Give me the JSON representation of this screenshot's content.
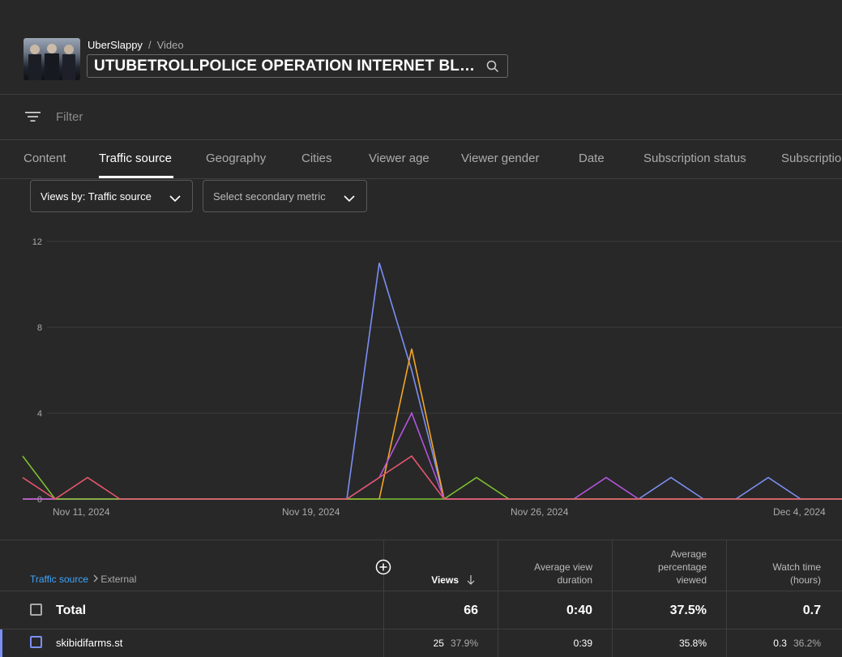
{
  "header": {
    "channel": "UberSlappy",
    "separator": "/",
    "section": "Video",
    "video_title": "UTUBETROLLPOLICE OPERATION INTERNET BLACKOUT"
  },
  "filter": {
    "placeholder": "Filter"
  },
  "tabs": [
    {
      "label": "Content"
    },
    {
      "label": "Traffic source",
      "active": true
    },
    {
      "label": "Geography"
    },
    {
      "label": "Cities"
    },
    {
      "label": "Viewer age"
    },
    {
      "label": "Viewer gender"
    },
    {
      "label": "Date"
    },
    {
      "label": "Subscription status"
    },
    {
      "label": "Subscription source"
    }
  ],
  "dropdowns": {
    "primary": "Views by: Traffic source",
    "secondary": "Select secondary metric"
  },
  "chart_data": {
    "type": "line",
    "title": "",
    "ylim": [
      0,
      12
    ],
    "yticks": [
      0,
      4,
      8,
      12
    ],
    "xlabels": [
      "Nov 11, 2024",
      "Nov 19, 2024",
      "Nov 26, 2024",
      "Dec 4, 2024"
    ],
    "x": [
      "2024-11-10",
      "2024-11-11",
      "2024-11-12",
      "2024-11-13",
      "2024-11-14",
      "2024-11-15",
      "2024-11-16",
      "2024-11-17",
      "2024-11-18",
      "2024-11-19",
      "2024-11-20",
      "2024-11-21",
      "2024-11-22",
      "2024-11-23",
      "2024-11-24",
      "2024-11-25",
      "2024-11-26",
      "2024-11-27",
      "2024-11-28",
      "2024-11-29",
      "2024-11-30",
      "2024-12-01",
      "2024-12-02",
      "2024-12-03",
      "2024-12-04",
      "2024-12-05",
      "2024-12-06"
    ],
    "grid": true,
    "series": [
      {
        "color": "#7b8ff5",
        "values": [
          0,
          0,
          0,
          0,
          0,
          0,
          0,
          0,
          0,
          0,
          0,
          11,
          6,
          0,
          0,
          0,
          0,
          0,
          0,
          0,
          1,
          0,
          0,
          1,
          0,
          0,
          0
        ]
      },
      {
        "color": "#f5a623",
        "values": [
          0,
          0,
          0,
          0,
          0,
          0,
          0,
          0,
          0,
          0,
          0,
          0,
          7,
          0,
          0,
          0,
          0,
          0,
          0,
          0,
          0,
          0,
          0,
          0,
          0,
          0,
          0
        ]
      },
      {
        "color": "#b455e0",
        "values": [
          0,
          0,
          0,
          0,
          0,
          0,
          0,
          0,
          0,
          0,
          0,
          1,
          4,
          0,
          0,
          0,
          0,
          0,
          1,
          0,
          0,
          0,
          0,
          0,
          0,
          0,
          0
        ]
      },
      {
        "color": "#7cc130",
        "values": [
          2,
          0,
          0,
          0,
          0,
          0,
          0,
          0,
          0,
          0,
          0,
          0,
          0,
          0,
          1,
          0,
          0,
          0,
          0,
          0,
          0,
          0,
          0,
          0,
          0,
          0,
          0
        ]
      },
      {
        "color": "#e5566e",
        "values": [
          1,
          0,
          1,
          0,
          0,
          0,
          0,
          0,
          0,
          0,
          0,
          1,
          2,
          0,
          0,
          0,
          0,
          0,
          0,
          0,
          0,
          0,
          0,
          0,
          0,
          0,
          0
        ]
      }
    ]
  },
  "table": {
    "breadcrumb_link": "Traffic source",
    "breadcrumb_current": "External",
    "columns": {
      "views": "Views",
      "avg_view_duration": "Average view duration",
      "avg_pct_viewed": "Average percentage viewed",
      "watch_time": "Watch time (hours)"
    },
    "total": {
      "label": "Total",
      "views": "66",
      "avg_view_duration": "0:40",
      "avg_pct_viewed": "37.5%",
      "watch_time": "0.7"
    },
    "rows": [
      {
        "label": "skibidifarms.st",
        "views": "25",
        "views_pct": "37.9%",
        "avg_view_duration": "0:39",
        "avg_pct_viewed": "35.8%",
        "watch_time": "0.3",
        "watch_time_pct": "36.2%",
        "color": "#7b8ff5"
      }
    ]
  }
}
